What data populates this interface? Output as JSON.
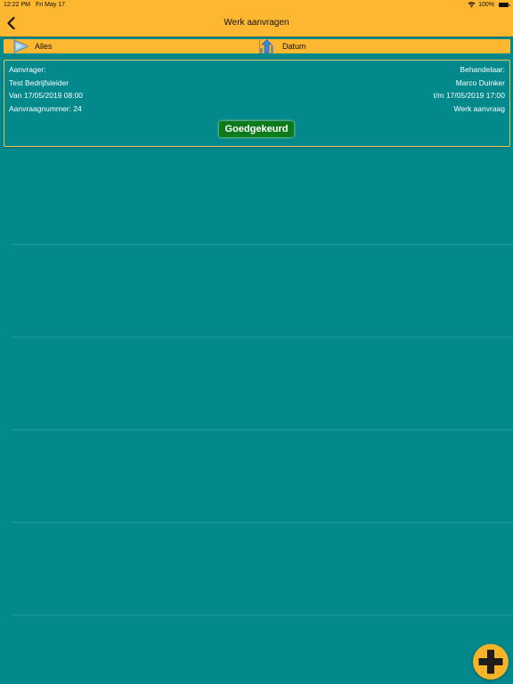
{
  "status_bar": {
    "time": "12:22 PM",
    "date": "Fri May 17",
    "battery": "100%"
  },
  "nav": {
    "title": "Werk aanvragen",
    "back_icon": "chevron-left-icon"
  },
  "filters": {
    "left": {
      "label": "Alles",
      "icon": "filter-funnel-icon"
    },
    "right": {
      "label": "Datum",
      "icon": "sort-up-arrow-icon"
    }
  },
  "request": {
    "requester_label": "Aanvrager:",
    "requester_name": "Test Bedrijfsleider",
    "from": "Van 17/05/2019 08:00",
    "number": "Aanvraagnummer: 24",
    "handler_label": "Behandelaar:",
    "handler_name": "Marco Duinker",
    "until": "t/m 17/05/2019 17:00",
    "type": "Werk aanvraag",
    "status": "Goedgekeurd"
  },
  "fab": {
    "icon": "plus-icon"
  },
  "colors": {
    "bar": "#FDB731",
    "background": "#03888C",
    "status_approved": "#0D7A1B",
    "fab": "#F4B328"
  }
}
